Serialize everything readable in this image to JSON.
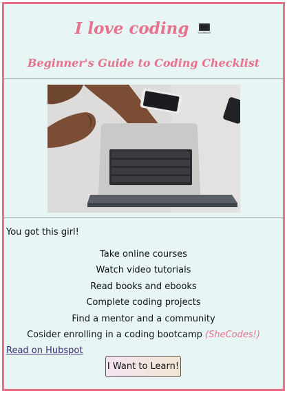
{
  "header": {
    "title": "I love coding",
    "title_icon": "laptop-emoji",
    "subtitle": "Beginner's Guide to Coding Checklist"
  },
  "hero_image": {
    "description_icon": "laptop-hands-photo"
  },
  "main": {
    "lead": "You got this girl!",
    "checklist": [
      "Take online courses",
      "Watch video tutorials",
      "Read books and ebooks",
      "Complete coding projects",
      "Find a mentor and a community",
      "Cosider enrolling in a coding bootcamp"
    ],
    "checklist_highlight": "(SheCodes!)"
  },
  "footer": {
    "link_label": "Read on Hubspot",
    "cta_label": "I Want to Learn!"
  },
  "colors": {
    "accent": "#e8718b",
    "background": "#e7f6f5",
    "link": "#3a2a7a"
  }
}
